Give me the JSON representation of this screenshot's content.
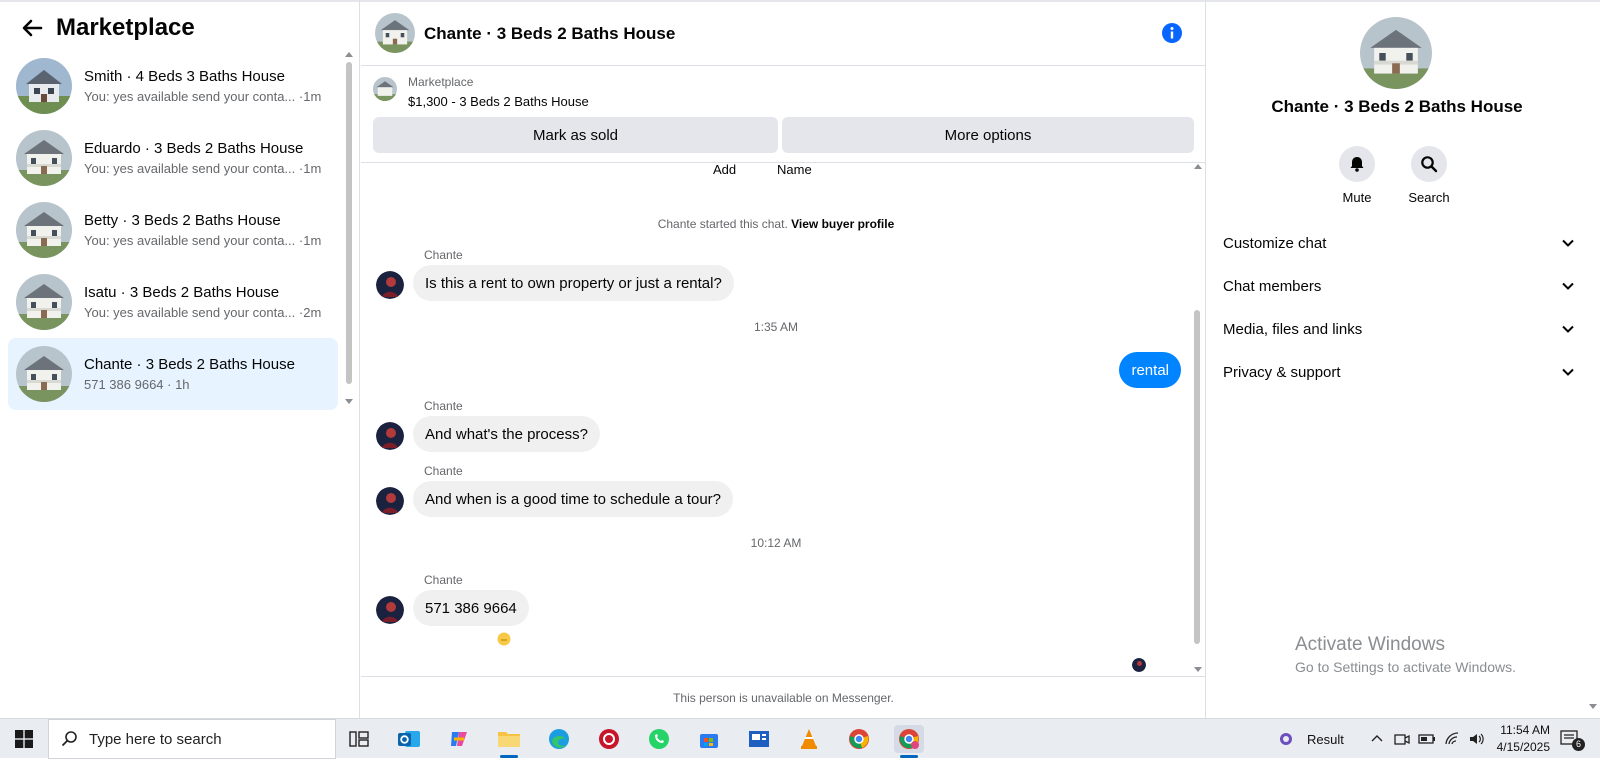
{
  "left": {
    "title": "Marketplace",
    "conversations": [
      {
        "name": "Smith · 4 Beds 3 Baths House",
        "preview": "You: yes available send your conta... ·1m"
      },
      {
        "name": "Eduardo · 3 Beds 2 Baths House",
        "preview": "You: yes available send your conta... ·1m"
      },
      {
        "name": "Betty · 3 Beds 2 Baths House",
        "preview": "You: yes available send your conta... ·1m"
      },
      {
        "name": "Isatu · 3 Beds 2 Baths House",
        "preview": "You: yes available send your conta... ·2m"
      },
      {
        "name": "Chante · 3 Beds 2 Baths House",
        "preview": "571 386 9664 · 1h"
      }
    ]
  },
  "chat": {
    "title": "Chante · 3 Beds 2 Baths House",
    "listing": {
      "category": "Marketplace",
      "price_title": "$1,300 - 3 Beds 2 Baths House",
      "mark_sold": "Mark as sold",
      "more_options": "More options"
    },
    "cut_labels": {
      "add": "Add",
      "name": "Name"
    },
    "started_text": "Chante started this chat.",
    "view_profile": "View buyer profile",
    "messages": [
      {
        "sender": "Chante",
        "text": "Is this a rent to own property or just a rental?"
      },
      {
        "stamp": "1:35 AM"
      },
      {
        "outgoing": "rental"
      },
      {
        "sender": "Chante",
        "text": "And what's the process?"
      },
      {
        "sender": "Chante",
        "text": "And when is a good time to schedule a tour?"
      },
      {
        "stamp": "10:12 AM"
      },
      {
        "sender": "Chante",
        "text": "571 386 9664"
      }
    ],
    "footer": "This person is unavailable on Messenger."
  },
  "right": {
    "title": "Chante · 3 Beds 2 Baths House",
    "actions": {
      "mute": "Mute",
      "search": "Search"
    },
    "sections": [
      "Customize chat",
      "Chat members",
      "Media, files and links",
      "Privacy & support"
    ],
    "watermark": {
      "line1": "Activate Windows",
      "line2": "Go to Settings to activate Windows."
    }
  },
  "taskbar": {
    "search_placeholder": "Type here to search",
    "weather": "Result",
    "time": "11:54 AM",
    "date": "4/15/2025",
    "notifications": "6"
  },
  "colors": {
    "accent": "#0084ff",
    "active_conv": "#e7f3ff",
    "bubble_in": "#f0f0f0"
  }
}
